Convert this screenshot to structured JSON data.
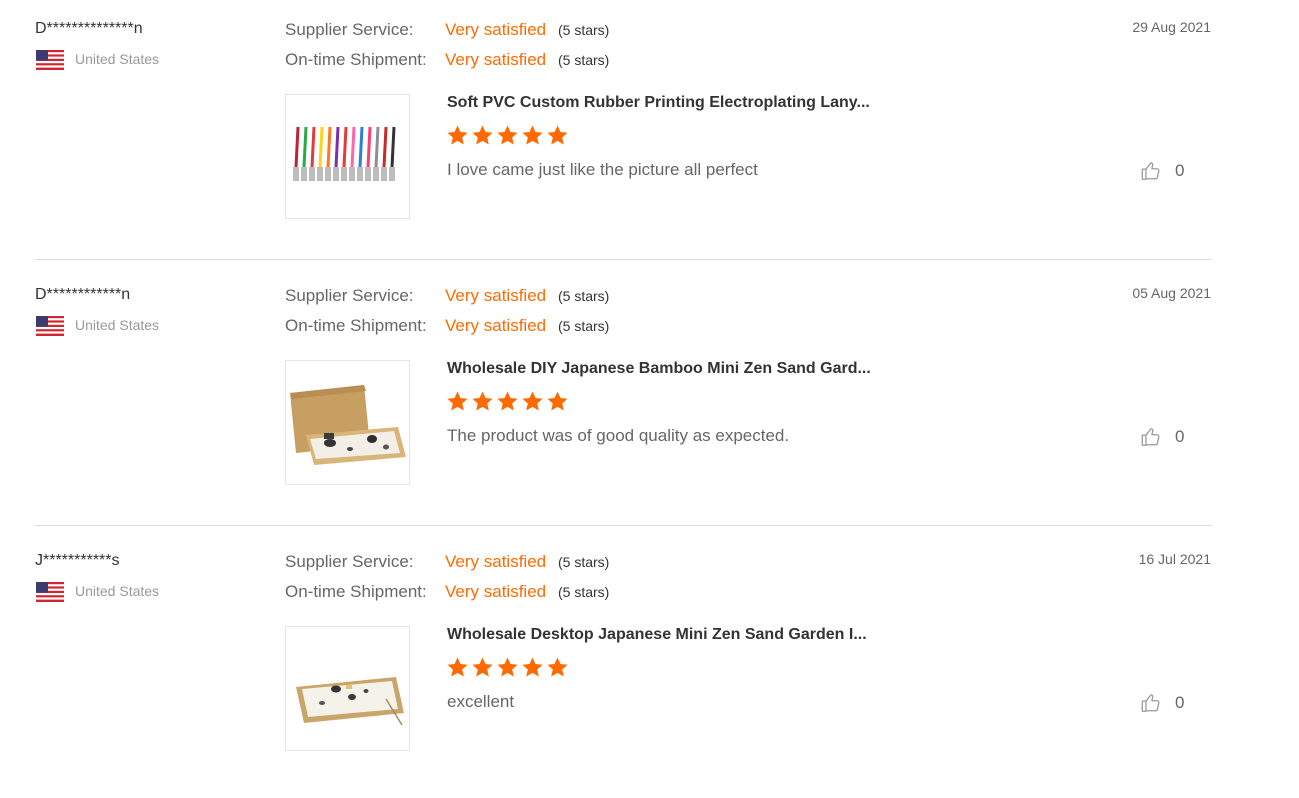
{
  "colors": {
    "accent": "#ff6a00",
    "label_gray": "#666666",
    "country_gray": "#999999",
    "divider": "#dddddd"
  },
  "icons": {
    "flag": "us-flag-icon",
    "star": "star-icon",
    "like": "thumbs-up-icon"
  },
  "reviews": [
    {
      "buyer": "D**************n",
      "country": "United States",
      "supplier_service_label": "Supplier Service:",
      "supplier_service_value": "Very satisfied",
      "supplier_service_stars": "(5 stars)",
      "shipment_label": "On-time Shipment:",
      "shipment_value": "Very satisfied",
      "shipment_stars": "(5 stars)",
      "date": "29 Aug 2021",
      "product_title": "Soft PVC Custom Rubber Printing Electroplating Lany...",
      "rating": 5,
      "text": "I love came just like the picture all perfect",
      "likes": "0",
      "image": "colorful-lanyards"
    },
    {
      "buyer": "D************n",
      "country": "United States",
      "supplier_service_label": "Supplier Service:",
      "supplier_service_value": "Very satisfied",
      "supplier_service_stars": "(5 stars)",
      "shipment_label": "On-time Shipment:",
      "shipment_value": "Very satisfied",
      "shipment_stars": "(5 stars)",
      "date": "05 Aug 2021",
      "product_title": "Wholesale DIY Japanese Bamboo Mini Zen Sand Gard...",
      "rating": 5,
      "text": "The product was of good quality as expected.",
      "likes": "0",
      "image": "zen-garden-box"
    },
    {
      "buyer": "J***********s",
      "country": "United States",
      "supplier_service_label": "Supplier Service:",
      "supplier_service_value": "Very satisfied",
      "supplier_service_stars": "(5 stars)",
      "shipment_label": "On-time Shipment:",
      "shipment_value": "Very satisfied",
      "shipment_stars": "(5 stars)",
      "date": "16 Jul 2021",
      "product_title": "Wholesale Desktop Japanese Mini Zen Sand Garden I...",
      "rating": 5,
      "text": "excellent",
      "likes": "0",
      "image": "zen-garden-tray"
    }
  ]
}
